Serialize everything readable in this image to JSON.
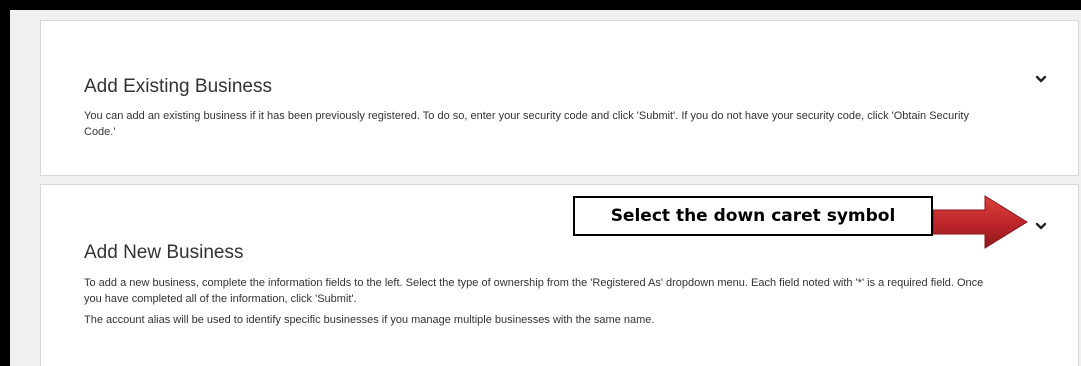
{
  "panels": [
    {
      "title": "Add Existing Business",
      "description": "You can add an existing business if it has been previously registered. To do so, enter your security code and click 'Submit'. If you do not have your security code, click 'Obtain Security Code.'",
      "toggle_icon": "chevron-down-icon"
    },
    {
      "title": "Add New Business",
      "description": "To add a new business, complete the information fields to the left. Select the type of ownership from the 'Registered As' dropdown menu. Each field noted with '*' is a required field. Once you have completed all of the information, click 'Submit'.",
      "note": "The account alias will be used to identify specific businesses if you manage multiple businesses with the same name.",
      "toggle_icon": "chevron-down-icon"
    }
  ],
  "annotation": {
    "callout_text": "Select the down caret symbol",
    "arrow_color": "#c0262b"
  },
  "colors": {
    "panel_bg": "#ffffff",
    "page_bg": "#f1f1f1",
    "frame": "#000000",
    "text": "#333333"
  }
}
